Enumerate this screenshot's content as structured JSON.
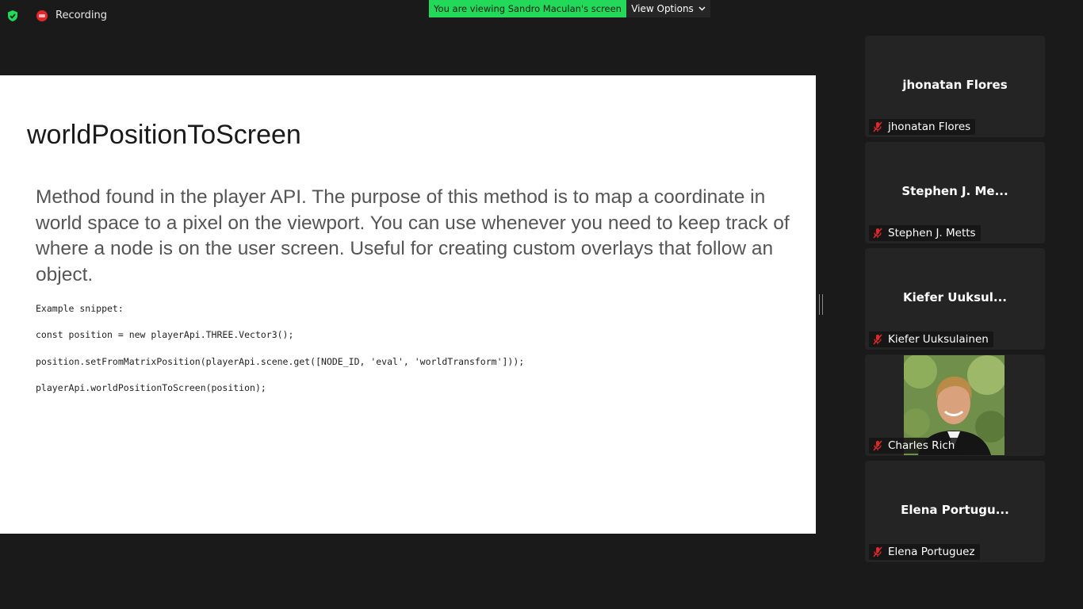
{
  "topbar": {
    "recording_label": "Recording",
    "viewing_banner": "You are viewing Sandro Maculan's screen",
    "view_options_label": "View Options"
  },
  "slide": {
    "title": "worldPositionToScreen",
    "body": "Method found in the player API. The purpose of this method is to map a coordinate in world space to a pixel on the viewport. You can use whenever you need to keep track of where a node is on the user screen. Useful for creating custom overlays that follow an object.",
    "code": [
      "Example snippet:",
      "const position = new playerApi.THREE.Vector3();",
      "position.setFromMatrixPosition(playerApi.scene.get([NODE_ID, 'eval', 'worldTransform']));",
      "playerApi.worldPositionToScreen(position);"
    ]
  },
  "participants": [
    {
      "display_name": "jhonatan Flores",
      "label": "jhonatan Flores",
      "muted": true,
      "video": false
    },
    {
      "display_name": "Stephen J. Me...",
      "label": "Stephen J. Metts",
      "muted": true,
      "video": false
    },
    {
      "display_name": "Kiefer Uuksul...",
      "label": "Kiefer Uuksulainen",
      "muted": true,
      "video": false
    },
    {
      "display_name": "",
      "label": "Charles Rich",
      "muted": true,
      "video": true
    },
    {
      "display_name": "Elena Portugu...",
      "label": "Elena Portuguez",
      "muted": true,
      "video": false
    }
  ],
  "colors": {
    "banner_green": "#23d959",
    "mute_red": "#e02828",
    "shield_green": "#23d959"
  }
}
